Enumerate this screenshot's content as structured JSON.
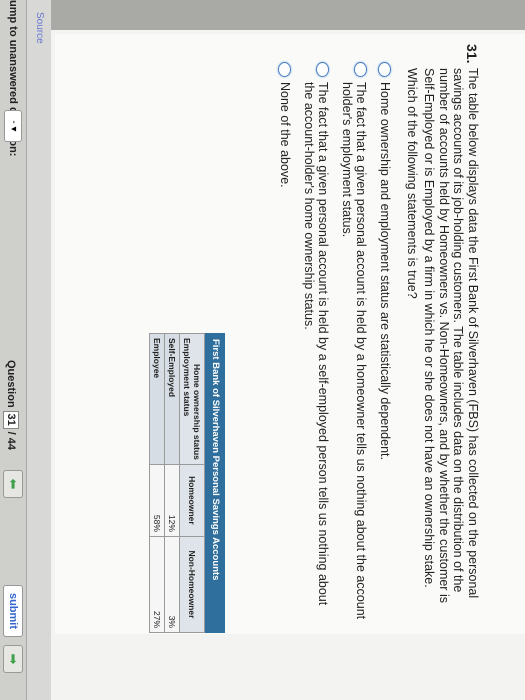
{
  "question": {
    "number": "31.",
    "text": "The table below displays data the First Bank of Silverhaven (FBS) has collected on the personal savings accounts of its job-holding customers. The table includes data on the distribution of the number of accounts held by Homeowners vs. Non-Homeowners, and by whether the customer is Self-Employed or is Employed by a firm in which he or she does not have an ownership stake.",
    "prompt": "Which of the following statements is true?",
    "options": [
      "Home ownership and employment status are statistically dependent.",
      "The fact that a given personal account is held by a homeowner tells us nothing about the account holder's employment status.",
      "The fact that a given personal account is held by a self-employed person tells us nothing about the account-holder's home ownership status.",
      "None of the above."
    ]
  },
  "table": {
    "title": "First Bank of Silverhaven Personal Savings Accounts",
    "corner_top": "Home ownership status",
    "corner_bottom": "Employment status",
    "columns": [
      "Homeowner",
      "Non-Homeowner"
    ],
    "rows": [
      {
        "label": "Self-Employed",
        "values": [
          "12%",
          "3%"
        ]
      },
      {
        "label": "Employee",
        "values": [
          "58%",
          "27%"
        ]
      }
    ]
  },
  "source_link": "Source",
  "footer": {
    "jump_label": "ump to unanswered question:",
    "jump_value": "-",
    "question_label": "Question",
    "current": "31",
    "total": "/ 44",
    "submit": "submit"
  }
}
